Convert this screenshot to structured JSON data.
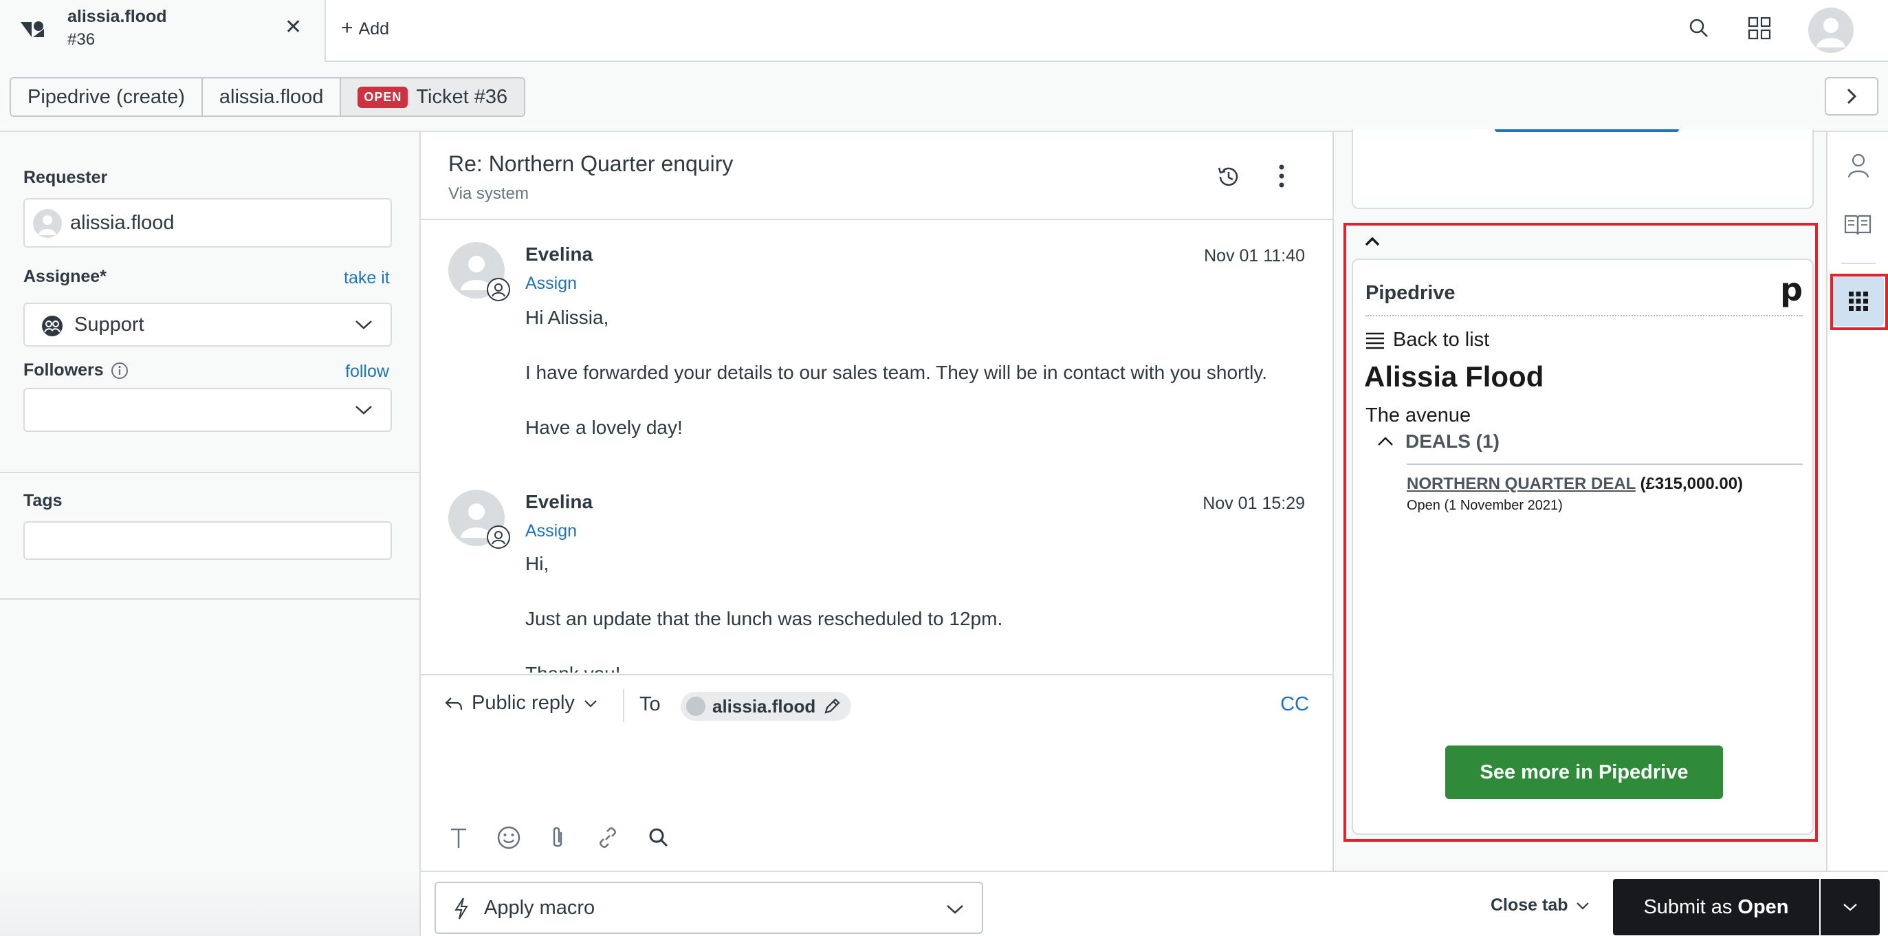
{
  "topbar": {
    "tab_title": "alissia.flood",
    "tab_subtitle": "#36",
    "add_label": "Add"
  },
  "breadcrumb": {
    "items": [
      "Pipedrive (create)",
      "alissia.flood"
    ],
    "status_badge": "OPEN",
    "ticket_label": "Ticket #36"
  },
  "properties": {
    "requester_label": "Requester",
    "requester_value": "alissia.flood",
    "assignee_label": "Assignee*",
    "take_it": "take it",
    "assignee_value": "Support",
    "followers_label": "Followers",
    "follow": "follow",
    "tags_label": "Tags"
  },
  "conversation": {
    "subject": "Re: Northern Quarter enquiry",
    "via": "Via system",
    "messages": [
      {
        "author": "Evelina",
        "assign": "Assign",
        "time": "Nov 01 11:40",
        "lines": [
          "Hi Alissia,",
          "I have forwarded your details to our sales team. They will be in contact with you shortly.",
          "Have a lovely day!"
        ]
      },
      {
        "author": "Evelina",
        "assign": "Assign",
        "time": "Nov 01 15:29",
        "lines": [
          "Hi,",
          "Just an update that the lunch was rescheduled to 12pm.",
          "Thank you!"
        ]
      }
    ]
  },
  "composer": {
    "reply_type": "Public reply",
    "to_label": "To",
    "recipient": "alissia.flood",
    "cc": "CC"
  },
  "pipedrive": {
    "title": "Pipedrive",
    "logo": "p",
    "back_to_list": "Back to list",
    "person": "Alissia Flood",
    "organization": "The avenue",
    "deals_header": "DEALS (1)",
    "deal_name": "NORTHERN QUARTER DEAL",
    "deal_value": "(£315,000.00)",
    "deal_status": "Open (1 November 2021)",
    "see_more": "See more in Pipedrive"
  },
  "footer": {
    "apply_macro": "Apply macro",
    "close_tab": "Close tab",
    "submit_prefix": "Submit as",
    "submit_status": "Open"
  },
  "colors": {
    "link": "#1f73b7",
    "open_badge": "#cc3340",
    "pipedrive_button": "#2f8a3a",
    "highlight": "#e3232b",
    "submit": "#17191c"
  }
}
